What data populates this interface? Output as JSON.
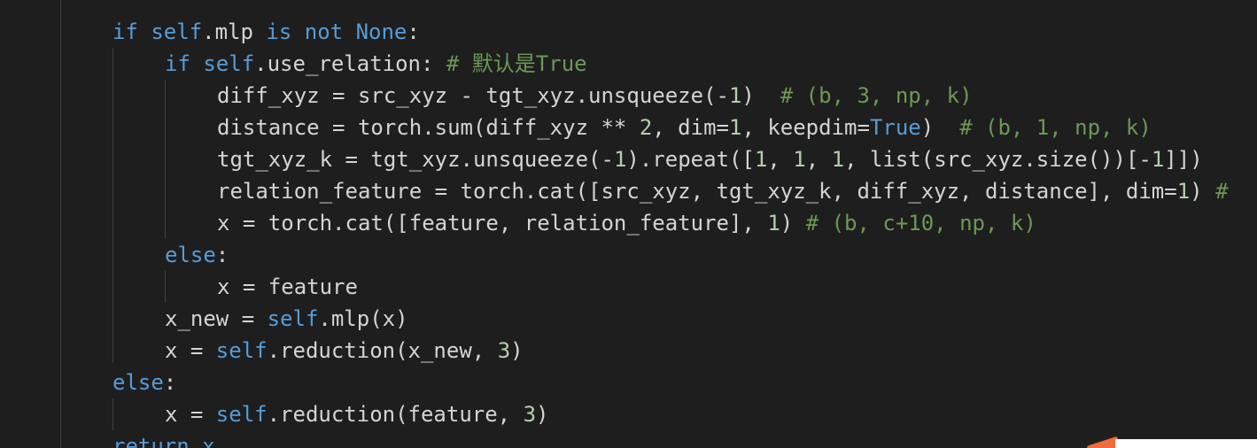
{
  "editor": {
    "lines": [
      {
        "indent": 127,
        "tokens": [
          {
            "t": "if",
            "c": "kw"
          },
          {
            "t": " ",
            "c": "id"
          },
          {
            "t": "self",
            "c": "self"
          },
          {
            "t": ".mlp ",
            "c": "id"
          },
          {
            "t": "is",
            "c": "kw"
          },
          {
            "t": " ",
            "c": "id"
          },
          {
            "t": "not",
            "c": "kw"
          },
          {
            "t": " ",
            "c": "id"
          },
          {
            "t": "None",
            "c": "kw"
          },
          {
            "t": ":",
            "c": "id"
          }
        ]
      },
      {
        "indent": 186,
        "tokens": [
          {
            "t": "if",
            "c": "kw"
          },
          {
            "t": " ",
            "c": "id"
          },
          {
            "t": "self",
            "c": "self"
          },
          {
            "t": ".use_relation: ",
            "c": "id"
          },
          {
            "t": "# 默认是True",
            "c": "cmt"
          }
        ]
      },
      {
        "indent": 245,
        "tokens": [
          {
            "t": "diff_xyz = src_xyz - tgt_xyz.unsqueeze(-",
            "c": "id"
          },
          {
            "t": "1",
            "c": "num"
          },
          {
            "t": ")  ",
            "c": "id"
          },
          {
            "t": "# (b, 3, np, k)",
            "c": "cmt"
          }
        ]
      },
      {
        "indent": 245,
        "tokens": [
          {
            "t": "distance = torch.sum(diff_xyz ** ",
            "c": "id"
          },
          {
            "t": "2",
            "c": "num"
          },
          {
            "t": ", dim=",
            "c": "id"
          },
          {
            "t": "1",
            "c": "num"
          },
          {
            "t": ", keepdim=",
            "c": "id"
          },
          {
            "t": "True",
            "c": "kw"
          },
          {
            "t": ")  ",
            "c": "id"
          },
          {
            "t": "# (b, 1, np, k)",
            "c": "cmt"
          }
        ]
      },
      {
        "indent": 245,
        "tokens": [
          {
            "t": "tgt_xyz_k = tgt_xyz.unsqueeze(-",
            "c": "id"
          },
          {
            "t": "1",
            "c": "num"
          },
          {
            "t": ").repeat([",
            "c": "id"
          },
          {
            "t": "1",
            "c": "num"
          },
          {
            "t": ", ",
            "c": "id"
          },
          {
            "t": "1",
            "c": "num"
          },
          {
            "t": ", ",
            "c": "id"
          },
          {
            "t": "1",
            "c": "num"
          },
          {
            "t": ", list(src_xyz.size())[-",
            "c": "id"
          },
          {
            "t": "1",
            "c": "num"
          },
          {
            "t": "]])",
            "c": "id"
          }
        ]
      },
      {
        "indent": 245,
        "tokens": [
          {
            "t": "relation_feature = torch.cat([src_xyz, tgt_xyz_k, diff_xyz, distance], dim=",
            "c": "id"
          },
          {
            "t": "1",
            "c": "num"
          },
          {
            "t": ") ",
            "c": "id"
          },
          {
            "t": "#",
            "c": "cmt"
          }
        ]
      },
      {
        "indent": 245,
        "tokens": [
          {
            "t": "x = torch.cat([feature, relation_feature], ",
            "c": "id"
          },
          {
            "t": "1",
            "c": "num"
          },
          {
            "t": ") ",
            "c": "id"
          },
          {
            "t": "# (b, c+10, np, k)",
            "c": "cmt"
          }
        ]
      },
      {
        "indent": 186,
        "tokens": [
          {
            "t": "else",
            "c": "kw"
          },
          {
            "t": ":",
            "c": "id"
          }
        ]
      },
      {
        "indent": 245,
        "tokens": [
          {
            "t": "x = feature",
            "c": "id"
          }
        ]
      },
      {
        "indent": 186,
        "tokens": [
          {
            "t": "x_new = ",
            "c": "id"
          },
          {
            "t": "self",
            "c": "self"
          },
          {
            "t": ".mlp(x)",
            "c": "id"
          }
        ]
      },
      {
        "indent": 186,
        "tokens": [
          {
            "t": "x = ",
            "c": "id"
          },
          {
            "t": "self",
            "c": "self"
          },
          {
            "t": ".reduction(x_new, ",
            "c": "id"
          },
          {
            "t": "3",
            "c": "num"
          },
          {
            "t": ")",
            "c": "id"
          }
        ]
      },
      {
        "indent": 127,
        "tokens": [
          {
            "t": "else",
            "c": "kw"
          },
          {
            "t": ":",
            "c": "id"
          }
        ]
      },
      {
        "indent": 186,
        "tokens": [
          {
            "t": "x = ",
            "c": "id"
          },
          {
            "t": "self",
            "c": "self"
          },
          {
            "t": ".reduction(feature, ",
            "c": "id"
          },
          {
            "t": "3",
            "c": "num"
          },
          {
            "t": ")",
            "c": "id"
          }
        ]
      },
      {
        "indent": 127,
        "tokens": [
          {
            "t": "return x",
            "c": "ctrl"
          }
        ]
      }
    ]
  },
  "colors": {
    "background": "#1e1e1e",
    "keyword": "#569cd6",
    "number": "#b5cea8",
    "comment": "#6a9955",
    "text": "#d4d4d4"
  }
}
